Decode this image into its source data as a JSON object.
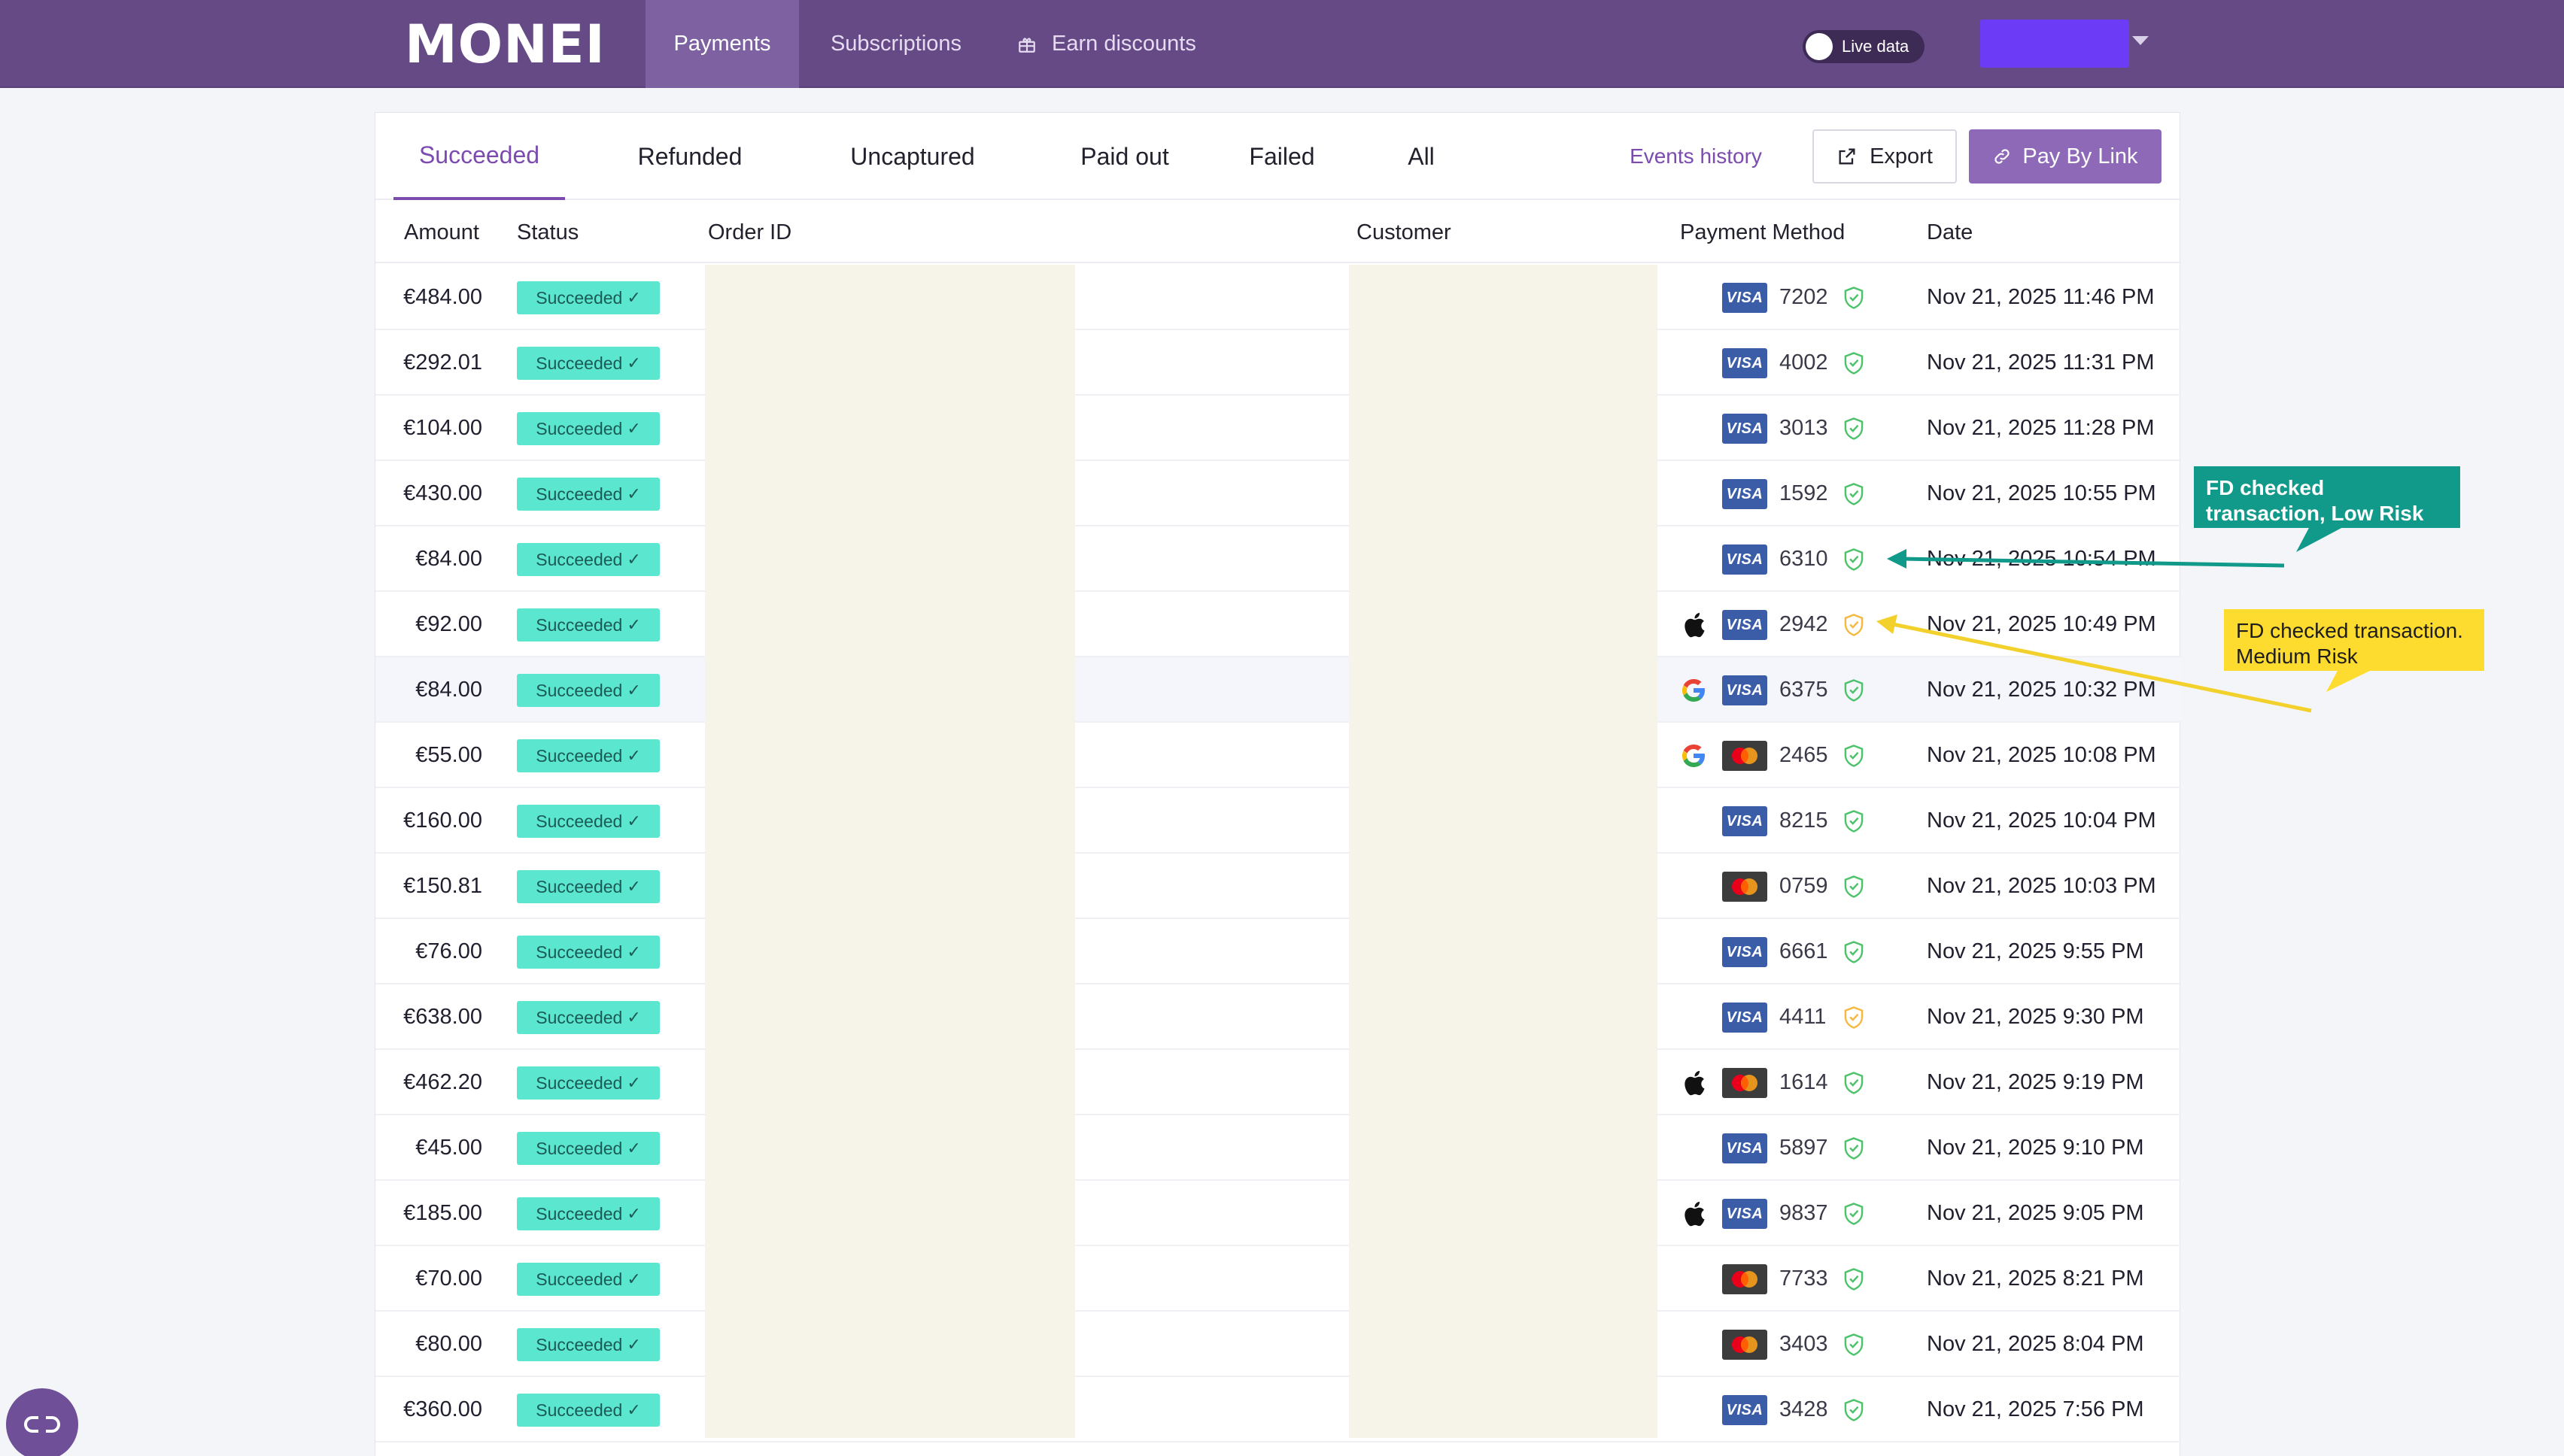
{
  "brand": {
    "logo_text": "MONEI"
  },
  "nav": {
    "payments": "Payments",
    "subscriptions": "Subscriptions",
    "earn_discounts": "Earn discounts",
    "live_data": "Live data"
  },
  "tabs": {
    "succeeded": "Succeeded",
    "refunded": "Refunded",
    "uncaptured": "Uncaptured",
    "paid_out": "Paid out",
    "failed": "Failed",
    "all": "All",
    "active": "Succeeded"
  },
  "actions": {
    "events_history": "Events history",
    "export": "Export",
    "pay_by_link": "Pay By Link"
  },
  "table": {
    "headers": {
      "amount": "Amount",
      "status": "Status",
      "order_id": "Order ID",
      "customer": "Customer",
      "payment_method": "Payment Method",
      "date": "Date"
    },
    "rows": [
      {
        "amount": "€484.00",
        "status": "Succeeded",
        "wallet": "",
        "brand": "visa",
        "last4": "7202",
        "risk": "low",
        "date": "Nov 21, 2025 11:46 PM"
      },
      {
        "amount": "€292.01",
        "status": "Succeeded",
        "wallet": "",
        "brand": "visa",
        "last4": "4002",
        "risk": "low",
        "date": "Nov 21, 2025 11:31 PM"
      },
      {
        "amount": "€104.00",
        "status": "Succeeded",
        "wallet": "",
        "brand": "visa",
        "last4": "3013",
        "risk": "low",
        "date": "Nov 21, 2025 11:28 PM"
      },
      {
        "amount": "€430.00",
        "status": "Succeeded",
        "wallet": "",
        "brand": "visa",
        "last4": "1592",
        "risk": "low",
        "date": "Nov 21, 2025 10:55 PM"
      },
      {
        "amount": "€84.00",
        "status": "Succeeded",
        "wallet": "",
        "brand": "visa",
        "last4": "6310",
        "risk": "low",
        "date": "Nov 21, 2025 10:54 PM"
      },
      {
        "amount": "€92.00",
        "status": "Succeeded",
        "wallet": "apple",
        "brand": "visa",
        "last4": "2942",
        "risk": "medium",
        "date": "Nov 21, 2025 10:49 PM"
      },
      {
        "amount": "€84.00",
        "status": "Succeeded",
        "wallet": "google",
        "brand": "visa",
        "last4": "6375",
        "risk": "low",
        "date": "Nov 21, 2025 10:32 PM"
      },
      {
        "amount": "€55.00",
        "status": "Succeeded",
        "wallet": "google",
        "brand": "mastercard",
        "last4": "2465",
        "risk": "low",
        "date": "Nov 21, 2025 10:08 PM"
      },
      {
        "amount": "€160.00",
        "status": "Succeeded",
        "wallet": "",
        "brand": "visa",
        "last4": "8215",
        "risk": "low",
        "date": "Nov 21, 2025 10:04 PM"
      },
      {
        "amount": "€150.81",
        "status": "Succeeded",
        "wallet": "",
        "brand": "mastercard",
        "last4": "0759",
        "risk": "low",
        "date": "Nov 21, 2025 10:03 PM"
      },
      {
        "amount": "€76.00",
        "status": "Succeeded",
        "wallet": "",
        "brand": "visa",
        "last4": "6661",
        "risk": "low",
        "date": "Nov 21, 2025 9:55 PM"
      },
      {
        "amount": "€638.00",
        "status": "Succeeded",
        "wallet": "",
        "brand": "visa",
        "last4": "4411",
        "risk": "medium",
        "date": "Nov 21, 2025 9:30 PM"
      },
      {
        "amount": "€462.20",
        "status": "Succeeded",
        "wallet": "apple",
        "brand": "mastercard",
        "last4": "1614",
        "risk": "low",
        "date": "Nov 21, 2025 9:19 PM"
      },
      {
        "amount": "€45.00",
        "status": "Succeeded",
        "wallet": "",
        "brand": "visa",
        "last4": "5897",
        "risk": "low",
        "date": "Nov 21, 2025 9:10 PM"
      },
      {
        "amount": "€185.00",
        "status": "Succeeded",
        "wallet": "apple",
        "brand": "visa",
        "last4": "9837",
        "risk": "low",
        "date": "Nov 21, 2025 9:05 PM"
      },
      {
        "amount": "€70.00",
        "status": "Succeeded",
        "wallet": "",
        "brand": "mastercard",
        "last4": "7733",
        "risk": "low",
        "date": "Nov 21, 2025 8:21 PM"
      },
      {
        "amount": "€80.00",
        "status": "Succeeded",
        "wallet": "",
        "brand": "mastercard",
        "last4": "3403",
        "risk": "low",
        "date": "Nov 21, 2025 8:04 PM"
      },
      {
        "amount": "€360.00",
        "status": "Succeeded",
        "wallet": "",
        "brand": "visa",
        "last4": "3428",
        "risk": "low",
        "date": "Nov 21, 2025 7:56 PM"
      }
    ]
  },
  "annotations": {
    "low_risk": "FD checked transaction, Low Risk",
    "medium_risk": "FD checked transaction. Medium Risk"
  },
  "icons": {
    "visa": "VISA",
    "check": "✓"
  },
  "colors": {
    "header_bg": "#664a86",
    "accent": "#7b4bb0",
    "badge_bg": "#5be6cf",
    "risk_low": "#4cc36a",
    "risk_medium": "#f5b942",
    "annotation_low": "#11998a",
    "annotation_medium": "#fedb2f"
  }
}
